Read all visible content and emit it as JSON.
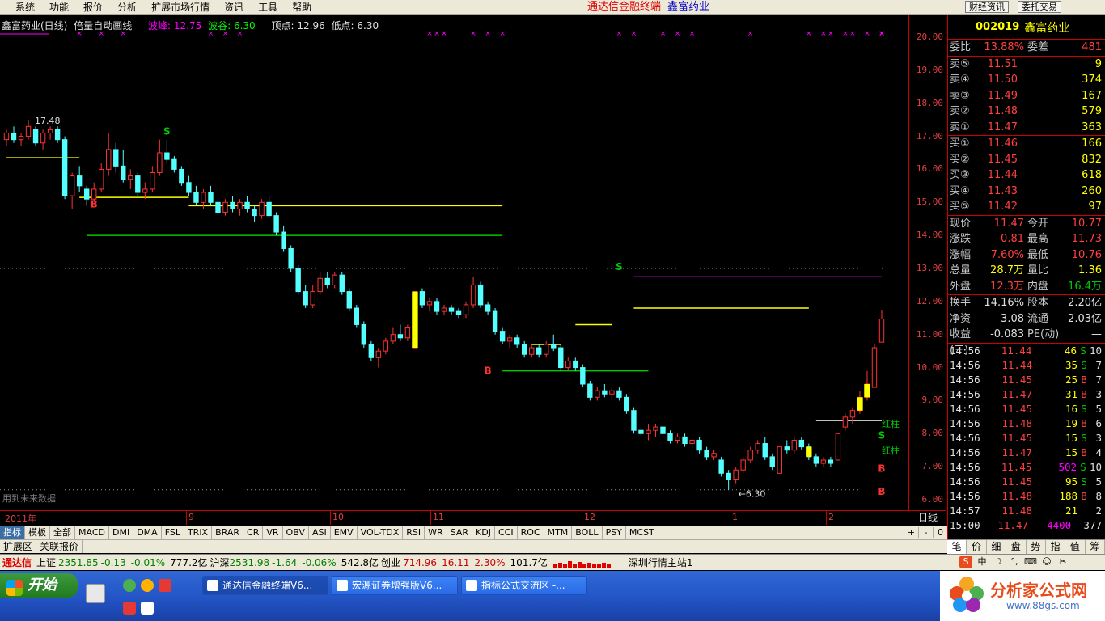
{
  "menu": {
    "items": [
      "系统",
      "功能",
      "报价",
      "分析",
      "扩展市场行情",
      "资讯",
      "工具",
      "帮助"
    ],
    "app_title": "通达信金融终端",
    "stock_title": "鑫富药业",
    "btn_news": "财经资讯",
    "btn_trade": "委托交易"
  },
  "chart": {
    "title": "鑫富药业(日线)",
    "indicator": "倍量自动画线",
    "peak_label": "波峰: 12.75",
    "trough_label": "波谷: 6.30",
    "top_label": "顶点: 12.96",
    "low_label": "低点: 6.30",
    "high_mark": "17.48",
    "low_mark": "6.30",
    "future_note": "用到未来数据",
    "price_ticks": [
      "20.00",
      "19.00",
      "18.00",
      "17.00",
      "16.00",
      "15.00",
      "14.00",
      "13.00",
      "12.00",
      "11.00",
      "10.00",
      "9.00",
      "8.00",
      "7.00",
      "6.00"
    ],
    "time_labels": [
      "2011年",
      "9",
      "10",
      "11",
      "12",
      "1",
      "2"
    ],
    "period": "日线",
    "annotations": [
      "S",
      "B",
      "S",
      "B",
      "S",
      "B",
      "S",
      "B",
      "红柱",
      "红柱"
    ]
  },
  "chart_data": {
    "type": "candlestick",
    "ylim": [
      6.0,
      20.0
    ],
    "candles": [
      [
        16.9,
        17.2,
        16.7,
        17.1
      ],
      [
        17.1,
        17.3,
        16.8,
        16.9
      ],
      [
        16.9,
        17.1,
        16.7,
        17.0
      ],
      [
        17.0,
        17.48,
        16.9,
        17.3
      ],
      [
        17.2,
        17.3,
        16.7,
        16.8
      ],
      [
        16.8,
        17.2,
        16.6,
        17.1
      ],
      [
        17.1,
        17.3,
        16.9,
        17.2
      ],
      [
        17.2,
        17.3,
        16.8,
        16.9
      ],
      [
        16.9,
        17.0,
        15.1,
        15.2
      ],
      [
        15.2,
        15.9,
        14.8,
        15.8
      ],
      [
        15.8,
        16.1,
        15.3,
        15.5
      ],
      [
        15.4,
        15.5,
        14.9,
        15.1
      ],
      [
        15.1,
        15.6,
        15.0,
        15.4
      ],
      [
        15.4,
        16.2,
        15.3,
        16.0
      ],
      [
        16.0,
        17.1,
        15.8,
        16.6
      ],
      [
        16.6,
        16.8,
        15.9,
        16.1
      ],
      [
        16.1,
        16.6,
        15.6,
        15.7
      ],
      [
        15.7,
        16.0,
        15.4,
        15.8
      ],
      [
        15.8,
        15.9,
        15.2,
        15.3
      ],
      [
        15.3,
        15.6,
        15.1,
        15.4
      ],
      [
        15.4,
        16.1,
        15.3,
        15.9
      ],
      [
        15.9,
        16.9,
        15.8,
        16.5
      ],
      [
        16.5,
        16.9,
        16.2,
        16.3
      ],
      [
        16.3,
        16.4,
        15.9,
        16.0
      ],
      [
        16.0,
        16.1,
        15.5,
        15.6
      ],
      [
        15.6,
        15.8,
        15.2,
        15.3
      ],
      [
        15.3,
        15.5,
        14.9,
        15.0
      ],
      [
        15.0,
        15.4,
        14.8,
        15.3
      ],
      [
        15.3,
        15.5,
        14.9,
        15.0
      ],
      [
        15.0,
        15.2,
        14.6,
        14.7
      ],
      [
        14.7,
        15.1,
        14.6,
        15.0
      ],
      [
        15.0,
        15.2,
        14.7,
        14.8
      ],
      [
        14.8,
        15.1,
        14.6,
        15.0
      ],
      [
        15.0,
        15.2,
        14.7,
        14.8
      ],
      [
        14.8,
        14.9,
        14.4,
        14.6
      ],
      [
        14.6,
        15.1,
        14.5,
        15.0
      ],
      [
        15.0,
        15.2,
        14.5,
        14.6
      ],
      [
        14.6,
        14.7,
        14.0,
        14.1
      ],
      [
        14.1,
        14.3,
        13.5,
        13.6
      ],
      [
        13.6,
        13.7,
        12.9,
        13.0
      ],
      [
        13.0,
        13.1,
        12.2,
        12.3
      ],
      [
        12.3,
        12.5,
        11.8,
        11.9
      ],
      [
        11.9,
        12.5,
        11.8,
        12.3
      ],
      [
        12.3,
        12.9,
        12.2,
        12.7
      ],
      [
        12.7,
        12.9,
        12.4,
        12.5
      ],
      [
        12.5,
        12.9,
        12.4,
        12.8
      ],
      [
        12.8,
        12.9,
        12.2,
        12.3
      ],
      [
        12.3,
        12.4,
        11.7,
        11.8
      ],
      [
        11.8,
        11.9,
        11.2,
        11.3
      ],
      [
        11.3,
        11.4,
        10.6,
        10.7
      ],
      [
        10.7,
        10.8,
        10.2,
        10.3
      ],
      [
        10.3,
        10.6,
        10.0,
        10.5
      ],
      [
        10.5,
        10.9,
        10.4,
        10.8
      ],
      [
        10.8,
        11.2,
        10.7,
        11.0
      ],
      [
        11.0,
        11.3,
        10.8,
        10.9
      ],
      [
        10.9,
        11.3,
        10.8,
        11.2
      ],
      [
        10.6,
        12.3,
        10.6,
        12.3
      ],
      [
        12.3,
        12.4,
        11.8,
        11.9
      ],
      [
        11.9,
        12.1,
        11.7,
        12.0
      ],
      [
        12.0,
        12.1,
        11.6,
        11.7
      ],
      [
        11.7,
        11.9,
        11.6,
        11.8
      ],
      [
        11.8,
        11.9,
        11.6,
        11.7
      ],
      [
        11.7,
        11.8,
        11.5,
        11.6
      ],
      [
        11.6,
        12.0,
        11.5,
        11.9
      ],
      [
        11.9,
        12.75,
        11.8,
        12.5
      ],
      [
        12.5,
        12.6,
        11.8,
        11.9
      ],
      [
        11.9,
        12.0,
        11.6,
        11.7
      ],
      [
        11.7,
        11.8,
        11.0,
        11.1
      ],
      [
        11.1,
        11.2,
        10.7,
        10.8
      ],
      [
        10.8,
        11.0,
        10.6,
        10.9
      ],
      [
        10.9,
        11.0,
        10.6,
        10.7
      ],
      [
        10.7,
        10.8,
        10.3,
        10.4
      ],
      [
        10.4,
        10.7,
        10.3,
        10.6
      ],
      [
        10.6,
        10.7,
        10.3,
        10.4
      ],
      [
        10.4,
        10.8,
        10.3,
        10.7
      ],
      [
        10.7,
        11.0,
        10.5,
        10.6
      ],
      [
        10.6,
        10.7,
        9.9,
        10.0
      ],
      [
        10.0,
        10.3,
        9.9,
        10.2
      ],
      [
        10.2,
        10.3,
        9.9,
        10.0
      ],
      [
        10.0,
        10.1,
        9.4,
        9.5
      ],
      [
        9.5,
        9.6,
        9.0,
        9.1
      ],
      [
        9.1,
        9.4,
        9.0,
        9.3
      ],
      [
        9.3,
        9.5,
        9.1,
        9.2
      ],
      [
        9.2,
        9.4,
        9.0,
        9.3
      ],
      [
        9.3,
        9.4,
        9.0,
        9.1
      ],
      [
        9.1,
        9.2,
        8.6,
        8.7
      ],
      [
        8.7,
        8.8,
        8.0,
        8.1
      ],
      [
        8.1,
        8.2,
        7.9,
        8.0
      ],
      [
        8.0,
        8.3,
        7.8,
        8.1
      ],
      [
        8.1,
        8.3,
        7.9,
        8.2
      ],
      [
        8.2,
        8.4,
        7.9,
        8.0
      ],
      [
        8.0,
        8.1,
        7.7,
        7.8
      ],
      [
        7.8,
        8.0,
        7.7,
        7.9
      ],
      [
        7.9,
        8.0,
        7.6,
        7.7
      ],
      [
        7.7,
        7.9,
        7.5,
        7.8
      ],
      [
        7.8,
        7.9,
        7.4,
        7.5
      ],
      [
        7.5,
        7.6,
        7.2,
        7.3
      ],
      [
        7.3,
        7.5,
        7.2,
        7.4
      ],
      [
        7.2,
        7.3,
        6.7,
        6.8
      ],
      [
        6.8,
        6.9,
        6.3,
        6.6
      ],
      [
        6.6,
        7.0,
        6.5,
        6.9
      ],
      [
        6.9,
        7.3,
        6.8,
        7.2
      ],
      [
        7.2,
        7.6,
        7.1,
        7.5
      ],
      [
        7.5,
        7.8,
        7.4,
        7.7
      ],
      [
        7.7,
        7.9,
        7.2,
        7.3
      ],
      [
        7.3,
        7.4,
        6.9,
        7.0
      ],
      [
        6.8,
        7.6,
        6.8,
        7.6
      ],
      [
        7.6,
        7.8,
        7.4,
        7.5
      ],
      [
        7.5,
        7.9,
        7.4,
        7.8
      ],
      [
        7.8,
        7.9,
        7.5,
        7.6
      ],
      [
        7.6,
        7.7,
        7.2,
        7.3
      ],
      [
        7.3,
        7.4,
        7.0,
        7.1
      ],
      [
        7.1,
        7.3,
        7.0,
        7.2
      ],
      [
        7.2,
        7.3,
        7.0,
        7.1
      ],
      [
        7.2,
        8.0,
        7.2,
        8.0
      ],
      [
        8.2,
        8.6,
        8.1,
        8.5
      ],
      [
        8.5,
        8.8,
        8.3,
        8.7
      ],
      [
        8.7,
        9.3,
        8.6,
        9.1
      ],
      [
        9.1,
        9.9,
        9.0,
        9.5
      ],
      [
        9.4,
        10.7,
        9.4,
        10.6
      ],
      [
        10.77,
        11.73,
        10.76,
        11.47
      ]
    ]
  },
  "quote": {
    "code": "002019",
    "name": "鑫富药业",
    "weibi_label": "委比",
    "weibi": "13.88%",
    "weicha_label": "委差",
    "weicha": "481",
    "asks": [
      {
        "label": "卖⑤",
        "price": "11.51",
        "vol": "9"
      },
      {
        "label": "卖④",
        "price": "11.50",
        "vol": "374"
      },
      {
        "label": "卖③",
        "price": "11.49",
        "vol": "167"
      },
      {
        "label": "卖②",
        "price": "11.48",
        "vol": "579"
      },
      {
        "label": "卖①",
        "price": "11.47",
        "vol": "363"
      }
    ],
    "bids": [
      {
        "label": "买①",
        "price": "11.46",
        "vol": "166"
      },
      {
        "label": "买②",
        "price": "11.45",
        "vol": "832"
      },
      {
        "label": "买③",
        "price": "11.44",
        "vol": "618"
      },
      {
        "label": "买④",
        "price": "11.43",
        "vol": "260"
      },
      {
        "label": "买⑤",
        "price": "11.42",
        "vol": "97"
      }
    ],
    "stats": [
      {
        "l1": "现价",
        "v1": "11.47",
        "l2": "今开",
        "v2": "10.77"
      },
      {
        "l1": "涨跌",
        "v1": "0.81",
        "l2": "最高",
        "v2": "11.73"
      },
      {
        "l1": "涨幅",
        "v1": "7.60%",
        "l2": "最低",
        "v2": "10.76"
      },
      {
        "l1": "总量",
        "v1": "28.7万",
        "l2": "量比",
        "v2": "1.36"
      },
      {
        "l1": "外盘",
        "v1": "12.3万",
        "l2": "内盘",
        "v2": "16.4万"
      }
    ],
    "stats2": [
      {
        "l1": "换手",
        "v1": "14.16%",
        "l2": "股本",
        "v2": "2.20亿"
      },
      {
        "l1": "净资",
        "v1": "3.08",
        "l2": "流通",
        "v2": "2.03亿"
      },
      {
        "l1": "收益(三)",
        "v1": "-0.083",
        "l2": "PE(动)",
        "v2": "—"
      }
    ],
    "ticks": [
      {
        "t": "14:56",
        "p": "11.44",
        "v": "46",
        "bs": "S",
        "n": "10"
      },
      {
        "t": "14:56",
        "p": "11.44",
        "v": "35",
        "bs": "S",
        "n": "7"
      },
      {
        "t": "14:56",
        "p": "11.45",
        "v": "25",
        "bs": "B",
        "n": "7"
      },
      {
        "t": "14:56",
        "p": "11.47",
        "v": "31",
        "bs": "B",
        "n": "3"
      },
      {
        "t": "14:56",
        "p": "11.45",
        "v": "16",
        "bs": "S",
        "n": "5"
      },
      {
        "t": "14:56",
        "p": "11.48",
        "v": "19",
        "bs": "B",
        "n": "6"
      },
      {
        "t": "14:56",
        "p": "11.45",
        "v": "15",
        "bs": "S",
        "n": "3"
      },
      {
        "t": "14:56",
        "p": "11.47",
        "v": "15",
        "bs": "B",
        "n": "4"
      },
      {
        "t": "14:56",
        "p": "11.45",
        "v": "502",
        "bs": "S",
        "n": "10"
      },
      {
        "t": "14:56",
        "p": "11.45",
        "v": "95",
        "bs": "S",
        "n": "5"
      },
      {
        "t": "14:56",
        "p": "11.48",
        "v": "188",
        "bs": "B",
        "n": "8"
      },
      {
        "t": "14:57",
        "p": "11.48",
        "v": "21",
        "bs": "",
        "n": "2"
      },
      {
        "t": "15:00",
        "p": "11.47",
        "v": "4400",
        "bs": "",
        "n": "377"
      }
    ],
    "tabs": [
      "笔",
      "价",
      "细",
      "盘",
      "势",
      "指",
      "值",
      "筹"
    ]
  },
  "indicator_tabs": [
    "指标",
    "模板",
    "全部",
    "MACD",
    "DMI",
    "DMA",
    "FSL",
    "TRIX",
    "BRAR",
    "CR",
    "VR",
    "OBV",
    "ASI",
    "EMV",
    "VOL-TDX",
    "RSI",
    "WR",
    "SAR",
    "KDJ",
    "CCI",
    "ROC",
    "MTM",
    "BOLL",
    "PSY",
    "MCST"
  ],
  "ind_nav": [
    "+",
    "-",
    "0"
  ],
  "ext_tabs": [
    "扩展区",
    "关联报价"
  ],
  "status": {
    "brand": "通达信",
    "sh_name": "上证",
    "sh_val": "2351.85",
    "sh_chg": "-0.13",
    "sh_pct": "-0.01%",
    "sh_amt": "777.2亿",
    "sz_name": "沪深",
    "sz_val": "2531.98",
    "sz_chg": "-1.64",
    "sz_pct": "-0.06%",
    "sz_amt": "542.8亿",
    "cy_name": "创业",
    "cy_val": "714.96",
    "cy_chg": "16.11",
    "cy_pct": "2.30%",
    "cy_amt": "101.7亿",
    "server": "深圳行情主站1"
  },
  "taskbar": {
    "start": "开始",
    "tasks": [
      "通达信金融终端V6...",
      "宏源证券增强版V6...",
      "指标公式交流区 -..."
    ],
    "site_name": "分析家公式网",
    "site_url": "www.88gs.com"
  },
  "colors": {
    "up": "#ff3232",
    "down": "#54ffff",
    "yellow": "#ffff00",
    "grid": "#c80000"
  }
}
